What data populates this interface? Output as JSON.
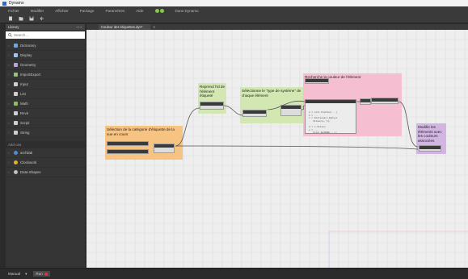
{
  "app": {
    "title": "Dynamo"
  },
  "menu": [
    "Fichier",
    "Modifier",
    "Affichier",
    "Package",
    "Paramètres",
    "Aide",
    "Dans Dynamo"
  ],
  "toolbar": [
    "new-icon",
    "open-icon",
    "save-icon",
    "undo-icon"
  ],
  "library": {
    "title": "Library",
    "search_placeholder": "Search...",
    "items": [
      {
        "label": "Dictionary",
        "icon": "dictionary-icon"
      },
      {
        "label": "Display",
        "icon": "display-icon"
      },
      {
        "label": "Geometry",
        "icon": "geometry-icon"
      },
      {
        "label": "ImportExport",
        "icon": "import-export-icon"
      },
      {
        "label": "Input",
        "icon": "input-icon"
      },
      {
        "label": "List",
        "icon": "list-icon"
      },
      {
        "label": "Math",
        "icon": "math-icon"
      },
      {
        "label": "Revit",
        "icon": "revit-icon"
      },
      {
        "label": "Script",
        "icon": "script-icon"
      },
      {
        "label": "String",
        "icon": "string-icon"
      }
    ],
    "addons_title": "Add-ons",
    "addons": [
      {
        "label": "archilab",
        "icon": "package-icon"
      },
      {
        "label": "Clockwork",
        "icon": "clockwork-icon"
      },
      {
        "label": "Data-Shapes",
        "icon": "data-shapes-icon"
      }
    ]
  },
  "workspace": {
    "tab": "Couleur des étiquettes.dyn*",
    "groups": [
      {
        "title": "Sélection de la catégorie d'étiquette de la vue en cours",
        "color": "#f7c382"
      },
      {
        "title": "Reprend l'Id de l'élément étiqueté",
        "color": "#d2e7b1"
      },
      {
        "title": "Sélectionne le \"type de système\" de chaque élément",
        "color": "#d2e7b1"
      },
      {
        "title": "Recherche la couleur de l'élément",
        "color": "#f5bfd1"
      },
      {
        "title": "Modifie les éléments avec les couleurs associées",
        "color": "#d3b5e4"
      }
    ],
    "code_lines": [
      "a = List.Flatten(...)",
      "b = ...",
      "c = Dictionary.ByKeys",
      "   Values(a, b);",
      "",
      "d = c.Values;",
      "e = ...",
      "   Color.ByARGB(...);"
    ]
  },
  "status": {
    "run_mode": "Manual",
    "run_label": "Run"
  }
}
